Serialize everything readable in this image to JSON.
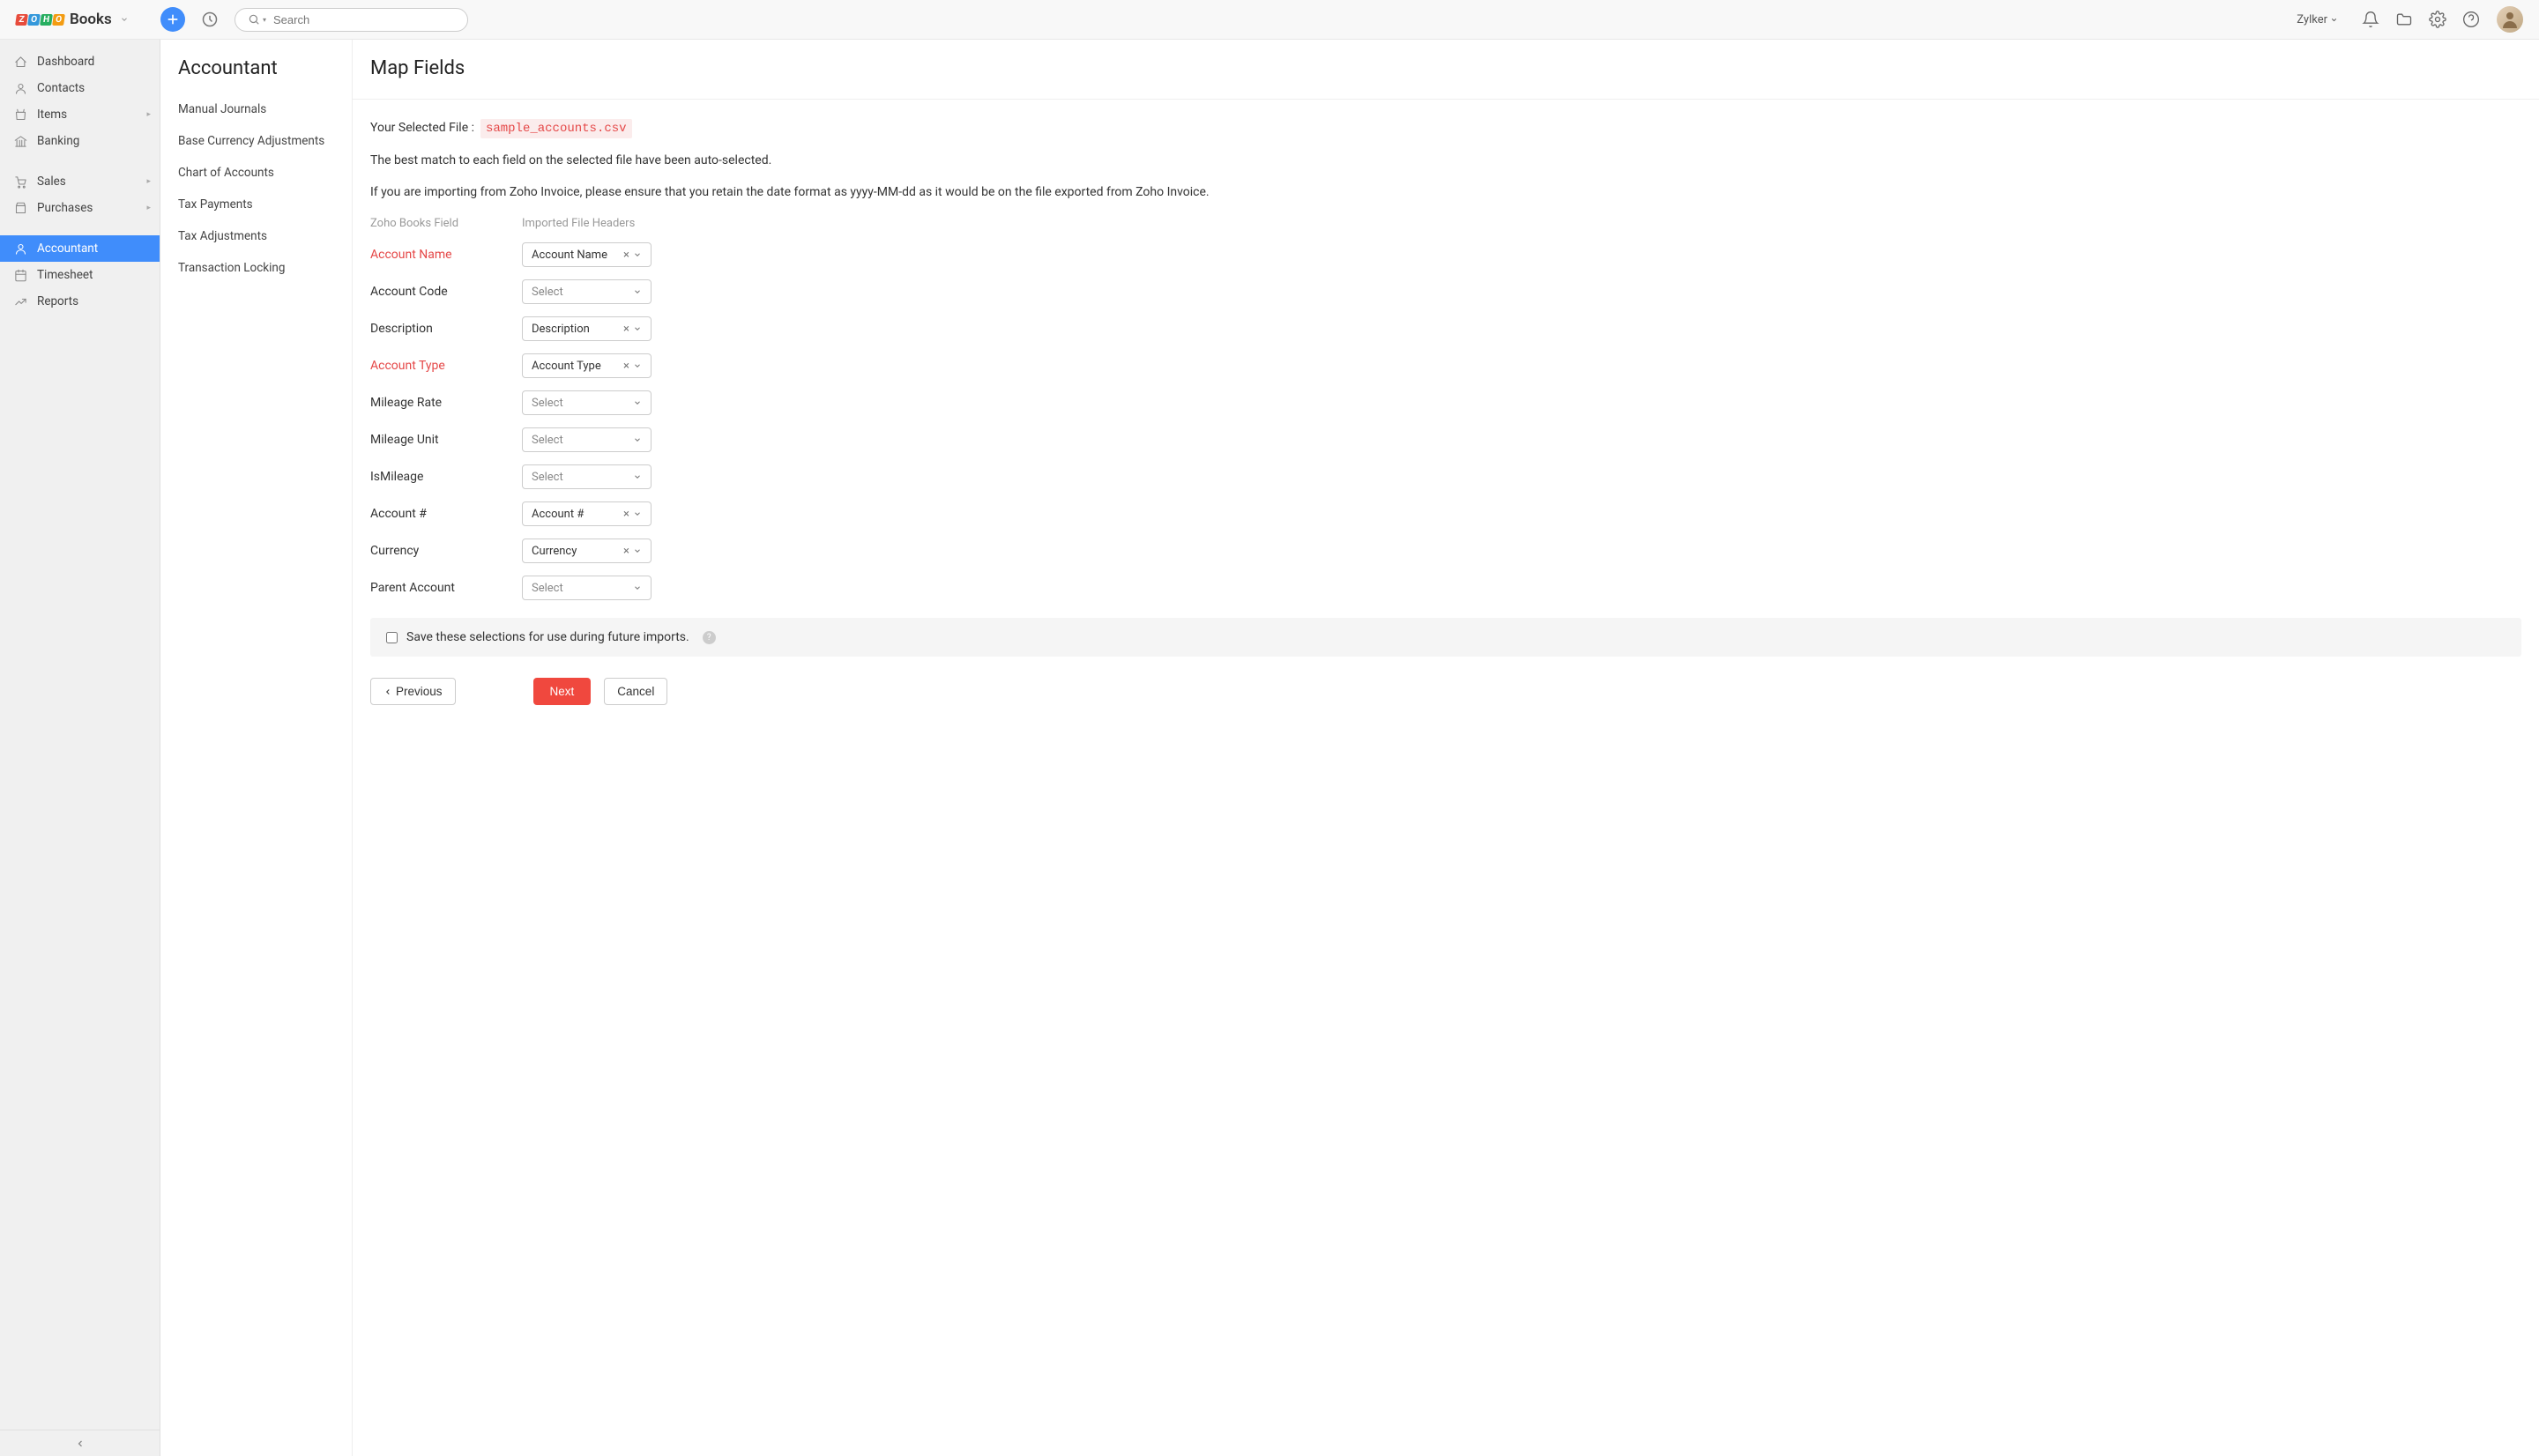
{
  "topbar": {
    "books_label": "Books",
    "search_placeholder": "Search",
    "org_name": "Zylker"
  },
  "sidebar": {
    "items": [
      {
        "label": "Dashboard",
        "icon": "dashboard",
        "expandable": false
      },
      {
        "label": "Contacts",
        "icon": "contacts",
        "expandable": false
      },
      {
        "label": "Items",
        "icon": "items",
        "expandable": true
      },
      {
        "label": "Banking",
        "icon": "banking",
        "expandable": false
      },
      {
        "gap": true
      },
      {
        "label": "Sales",
        "icon": "sales",
        "expandable": true
      },
      {
        "label": "Purchases",
        "icon": "purchases",
        "expandable": true
      },
      {
        "gap": true
      },
      {
        "label": "Accountant",
        "icon": "accountant",
        "expandable": false,
        "active": true
      },
      {
        "label": "Timesheet",
        "icon": "timesheet",
        "expandable": false
      },
      {
        "label": "Reports",
        "icon": "reports",
        "expandable": false
      }
    ]
  },
  "subside": {
    "title": "Accountant",
    "items": [
      "Manual Journals",
      "Base Currency Adjustments",
      "Chart of Accounts",
      "Tax Payments",
      "Tax Adjustments",
      "Transaction Locking"
    ]
  },
  "main": {
    "title": "Map Fields",
    "file_label": "Your Selected File :",
    "file_name": "sample_accounts.csv",
    "info1": "The best match to each field on the selected file have been auto-selected.",
    "info2": "If you are importing from Zoho Invoice, please ensure that you retain the date format as yyyy-MM-dd as it would be on the file exported from Zoho Invoice.",
    "col_h1": "Zoho Books Field",
    "col_h2": "Imported File Headers",
    "select_placeholder": "Select",
    "fields": [
      {
        "label": "Account Name",
        "value": "Account Name",
        "required": true
      },
      {
        "label": "Account Code",
        "value": "",
        "required": false
      },
      {
        "label": "Description",
        "value": "Description",
        "required": false
      },
      {
        "label": "Account Type",
        "value": "Account Type",
        "required": true
      },
      {
        "label": "Mileage Rate",
        "value": "",
        "required": false
      },
      {
        "label": "Mileage Unit",
        "value": "",
        "required": false
      },
      {
        "label": "IsMileage",
        "value": "",
        "required": false
      },
      {
        "label": "Account #",
        "value": "Account #",
        "required": false
      },
      {
        "label": "Currency",
        "value": "Currency",
        "required": false
      },
      {
        "label": "Parent Account",
        "value": "",
        "required": false
      }
    ],
    "save_label": "Save these selections for use during future imports.",
    "btn_prev": "Previous",
    "btn_next": "Next",
    "btn_cancel": "Cancel"
  }
}
